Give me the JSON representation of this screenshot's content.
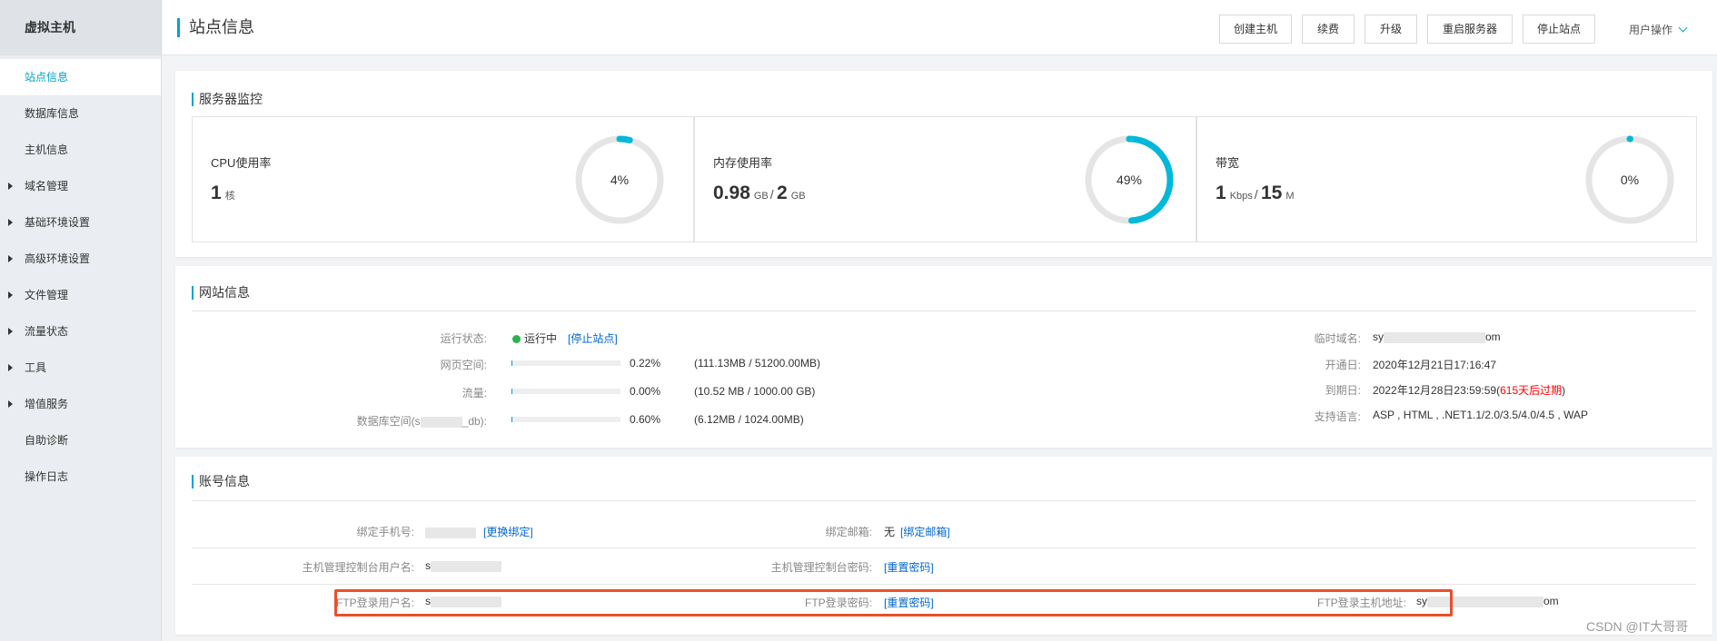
{
  "sidebar": {
    "title": "虚拟主机",
    "items": [
      {
        "label": "站点信息"
      },
      {
        "label": "数据库信息"
      },
      {
        "label": "主机信息"
      },
      {
        "label": "域名管理"
      },
      {
        "label": "基础环境设置"
      },
      {
        "label": "高级环境设置"
      },
      {
        "label": "文件管理"
      },
      {
        "label": "流量状态"
      },
      {
        "label": "工具"
      },
      {
        "label": "增值服务"
      },
      {
        "label": "自助诊断"
      },
      {
        "label": "操作日志"
      }
    ]
  },
  "header": {
    "title": "站点信息",
    "buttons": [
      "创建主机",
      "续费",
      "升级",
      "重启服务器",
      "停止站点"
    ],
    "user_menu": "用户操作"
  },
  "monitor": {
    "title": "服务器监控",
    "cpu": {
      "label": "CPU使用率",
      "value": "1",
      "unit": "核",
      "percent_text": "4%",
      "percent": 4
    },
    "memory": {
      "label": "内存使用率",
      "used": "0.98",
      "used_unit": "GB",
      "sep": "/",
      "total": "2",
      "total_unit": "GB",
      "percent_text": "49%",
      "percent": 49
    },
    "bandwidth": {
      "label": "带宽",
      "used": "1",
      "used_unit": "Kbps",
      "sep": "/",
      "total": "15",
      "total_unit": "M",
      "percent_text": "0%",
      "percent": 0
    },
    "colors": {
      "track": "#e5e5e5",
      "arc": "#00b8d9"
    }
  },
  "site": {
    "title": "网站信息",
    "run_status_label": "运行状态:",
    "run_status": "运行中",
    "stop_link": "[停止站点]",
    "web_space_label": "网页空间:",
    "web_space_pct": "0.22%",
    "web_space_pct_value": 0.22,
    "web_space_detail": "(111.13MB / 51200.00MB)",
    "traffic_label": "流量:",
    "traffic_pct": "0.00%",
    "traffic_pct_value": 0,
    "traffic_detail": "(10.52 MB / 1000.00 GB)",
    "db_space_label_prefix": "数据库空间(s",
    "db_space_label_suffix": "_db):",
    "db_space_pct": "0.60%",
    "db_space_pct_value": 0.6,
    "db_space_detail": "(6.12MB / 1024.00MB)",
    "temp_domain_label": "临时域名:",
    "temp_domain_prefix": "sy",
    "temp_domain_suffix": "om",
    "open_date_label": "开通日:",
    "open_date": "2020年12月21日17:16:47",
    "expire_label": "到期日:",
    "expire_date": "2022年12月28日23:59:59(",
    "expire_warning": "615天后过期",
    "expire_close": ")",
    "languages_label": "支持语言:",
    "languages": "ASP , HTML , .NET1.1/2.0/3.5/4.0/4.5 , WAP"
  },
  "account": {
    "title": "账号信息",
    "phone_label": "绑定手机号:",
    "phone_link": "[更换绑定]",
    "email_label": "绑定邮箱:",
    "email_value": "无",
    "email_link": "[绑定邮箱]",
    "console_user_label": "主机管理控制台用户名:",
    "console_user_prefix": "s",
    "console_pwd_label": "主机管理控制台密码:",
    "console_pwd_link": "[重置密码]",
    "ftp_user_label": "FTP登录用户名:",
    "ftp_user_prefix": "s",
    "ftp_pwd_label": "FTP登录密码:",
    "ftp_pwd_link": "[重置密码]",
    "ftp_host_label": "FTP登录主机地址:",
    "ftp_host_prefix": "sy",
    "ftp_host_suffix": "om"
  },
  "watermark": "CSDN @IT大哥哥"
}
